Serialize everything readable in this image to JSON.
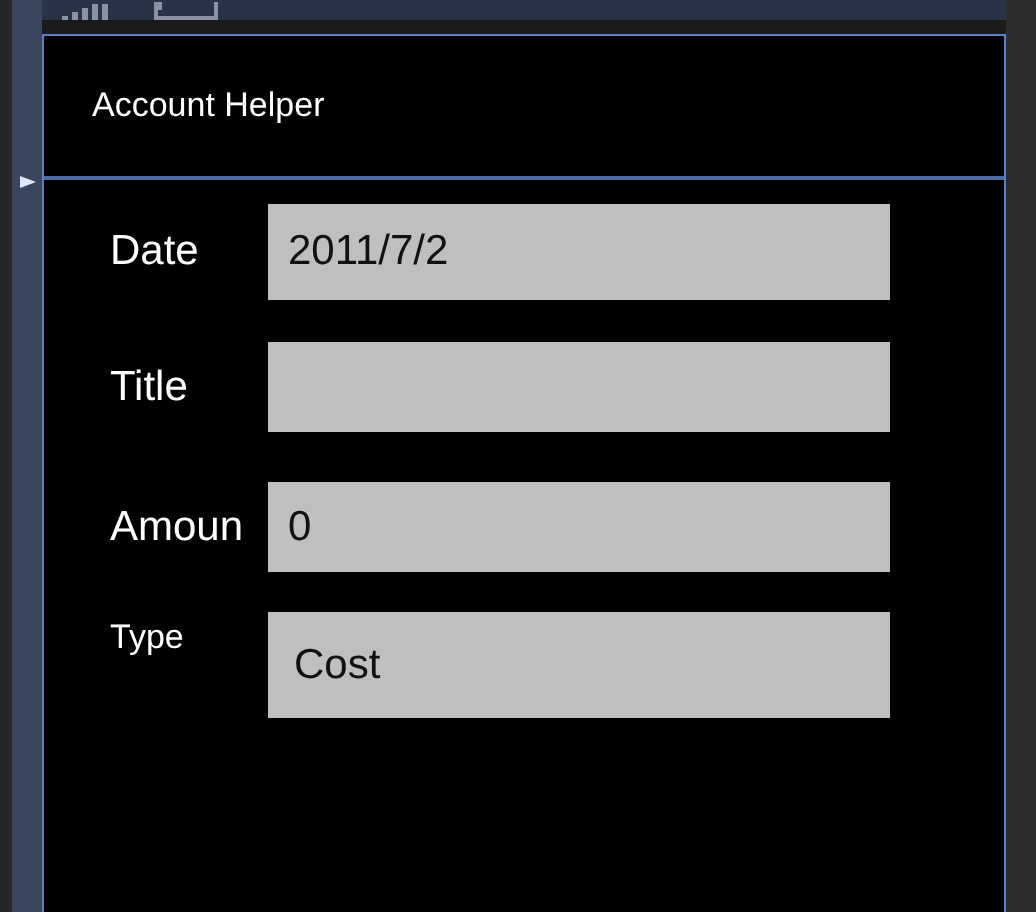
{
  "app": {
    "title": "Account Helper"
  },
  "fields": [
    {
      "label": "Date",
      "value": "2011/7/2",
      "kind": "text"
    },
    {
      "label": "Title",
      "kind": "text"
    },
    {
      "label": "Amoun",
      "value": "0",
      "kind": "text"
    },
    {
      "label": "Type",
      "value": "Cost",
      "kind": "select"
    }
  ]
}
